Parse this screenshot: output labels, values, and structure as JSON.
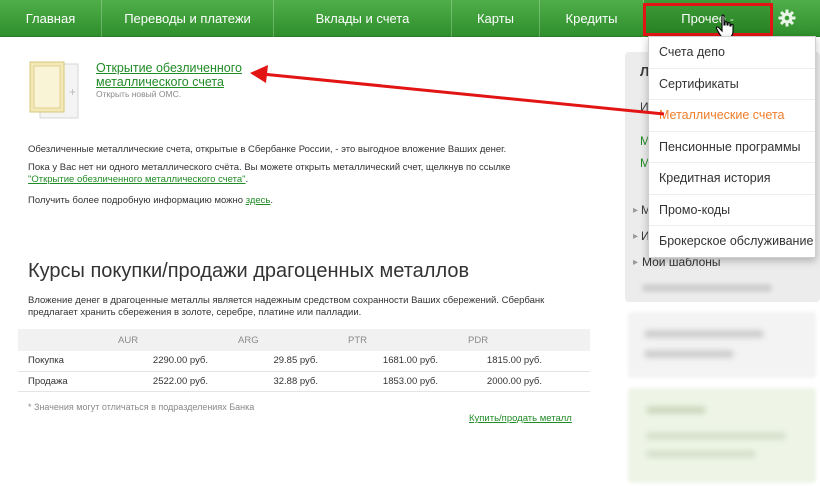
{
  "nav": {
    "items": [
      {
        "label": "Главная"
      },
      {
        "label": "Переводы и платежи"
      },
      {
        "label": "Вклады и счета"
      },
      {
        "label": "Карты"
      },
      {
        "label": "Кредиты"
      },
      {
        "label": "Прочее"
      }
    ],
    "more_caret": "-",
    "settings_icon": "gear-icon"
  },
  "dropdown": {
    "items": [
      {
        "label": "Счета депо"
      },
      {
        "label": "Сертификаты"
      },
      {
        "label": "Металлические счета",
        "highlight": true
      },
      {
        "label": "Пенсионные программы"
      },
      {
        "label": "Кредитная история"
      },
      {
        "label": "Промо-коды"
      },
      {
        "label": "Брокерское обслуживание"
      }
    ]
  },
  "sidebar": {
    "letters": [
      "Л",
      "И",
      "М",
      "М"
    ],
    "bullet_letters": [
      "М",
      "И"
    ],
    "templates_label": "Мои шаблоны"
  },
  "oms": {
    "title": "Открытие обезличенного металлического счета",
    "subtitle": "Открыть новый ОМС."
  },
  "info": {
    "line1": "Обезличенные металлические счета, открытые в Сбербанке России, - это выгодное вложение Ваших денег.",
    "line2": "Пока у Вас нет ни одного металлического счёта. Вы можете открыть металлический счет, щелкнув по ссылке",
    "line2_link": "\"Открытие обезличенного металлического счета\"",
    "line2_end": ".",
    "line3": "Получить более подробную информацию можно ",
    "line3_link": "здесь",
    "line3_end": "."
  },
  "rates": {
    "heading": "Курсы покупки/продажи драгоценных металлов",
    "description": "Вложение денег в драгоценные металлы является надежным средством сохранности Ваших сбережений. Сбербанк предлагает хранить сбережения в золоте, серебре, платине или палладии.",
    "columns": [
      "AUR",
      "ARG",
      "PTR",
      "PDR"
    ],
    "rows": [
      {
        "label": "Покупка",
        "values": [
          "2290.00 руб.",
          "29.85 руб.",
          "1681.00 руб.",
          "1815.00 руб."
        ]
      },
      {
        "label": "Продажа",
        "values": [
          "2522.00 руб.",
          "32.88 руб.",
          "1853.00 руб.",
          "2000.00 руб."
        ]
      }
    ],
    "note": "* Значения могут отличаться в подразделениях Банка",
    "buy_link": "Купить/продать металл"
  },
  "colors": {
    "nav_green": "#3a9c35",
    "link_green": "#218b26",
    "highlight_orange": "#ef7d2a",
    "annotation_red": "#e31414"
  }
}
